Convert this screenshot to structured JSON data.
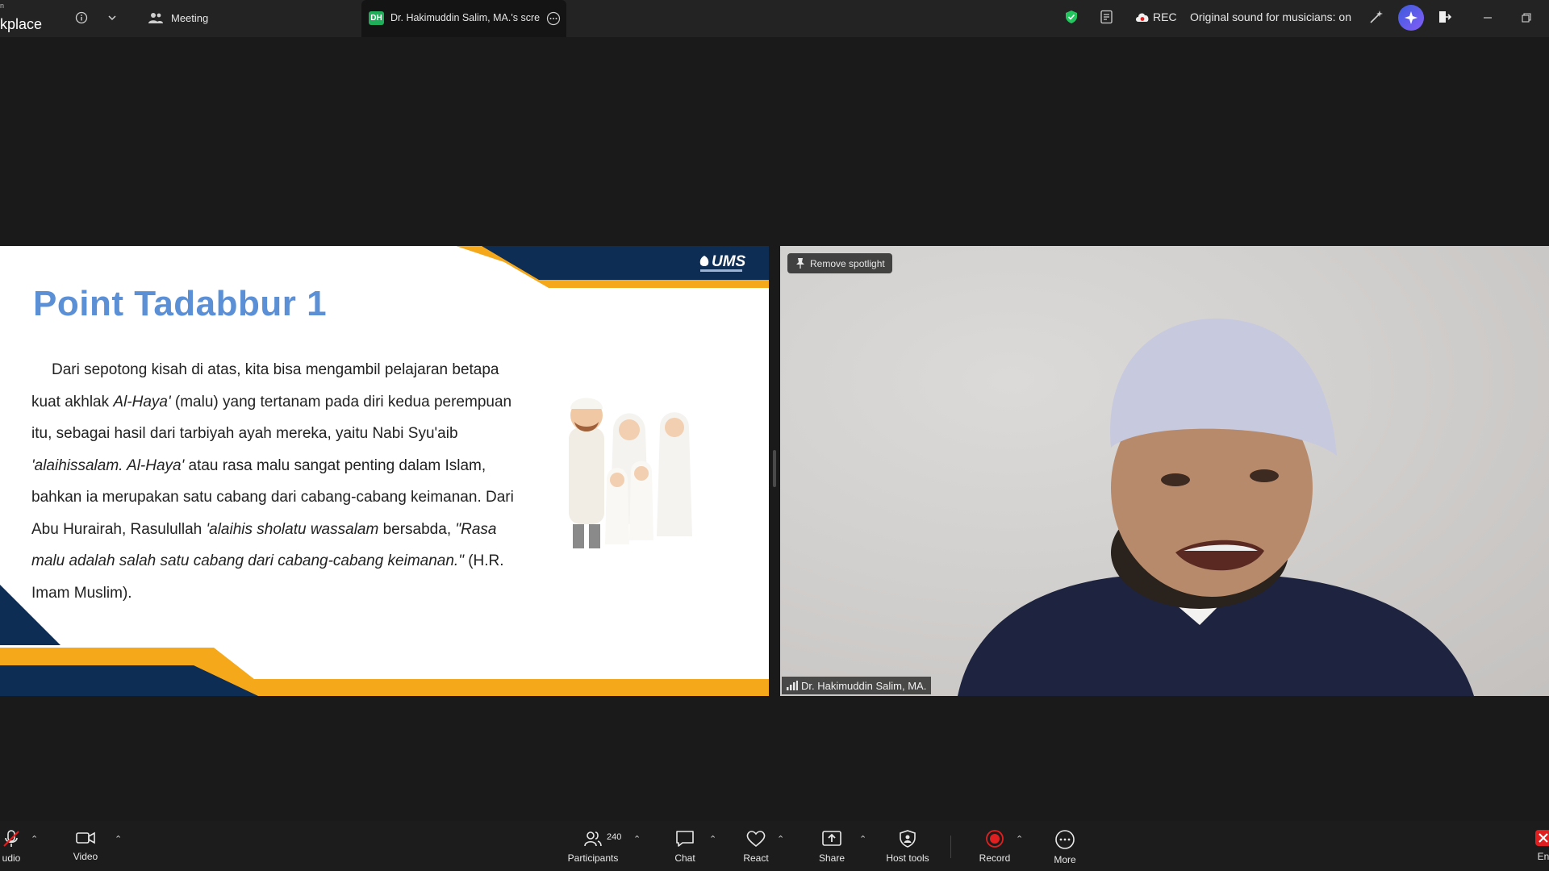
{
  "topbar": {
    "app_title_fragment": "kplace",
    "info_icon": "info-icon",
    "meeting_label": "Meeting",
    "share_tab_label": "Dr. Hakimuddin Salim, MA.'s scre",
    "share_tab_initials": "DH",
    "rec_label": "REC",
    "audio_status": "Original sound for musicians: on",
    "accent_green": "#1fae5a",
    "shield_color": "#22c55e"
  },
  "slide": {
    "logo": "UMS",
    "title": "Point Tadabbur 1",
    "body_parts": [
      "Dari sepotong kisah di atas, kita bisa mengambil pelajaran betapa kuat akhlak ",
      "Al-Haya'",
      " (malu) yang tertanam pada diri kedua perempuan itu, sebagai hasil dari tarbiyah ayah mereka, yaitu Nabi Syu'aib ",
      "'alaihissalam. Al-Haya'",
      " atau rasa malu sangat penting dalam Islam, bahkan ia merupakan satu cabang dari cabang-cabang keimanan. Dari Abu Hurairah, Rasulullah ",
      "'alaihis sholatu wassalam",
      " bersabda, ",
      "\"Rasa malu adalah salah satu cabang dari cabang-cabang keimanan.\"",
      " (H.R. Imam Muslim)."
    ],
    "colors": {
      "navy": "#0d2d55",
      "gold": "#f6a81b",
      "title_blue": "#5b8fd6"
    }
  },
  "video": {
    "remove_spotlight_label": "Remove spotlight",
    "participant_name": "Dr. Hakimuddin Salim, MA."
  },
  "toolbar": {
    "audio_label": "udio",
    "video_label": "Video",
    "participants_label": "Participants",
    "participants_count": "240",
    "chat_label": "Chat",
    "react_label": "React",
    "share_label": "Share",
    "host_tools_label": "Host tools",
    "record_label": "Record",
    "more_label": "More",
    "end_label": "En",
    "record_color": "#e02020",
    "end_color": "#e02020"
  }
}
